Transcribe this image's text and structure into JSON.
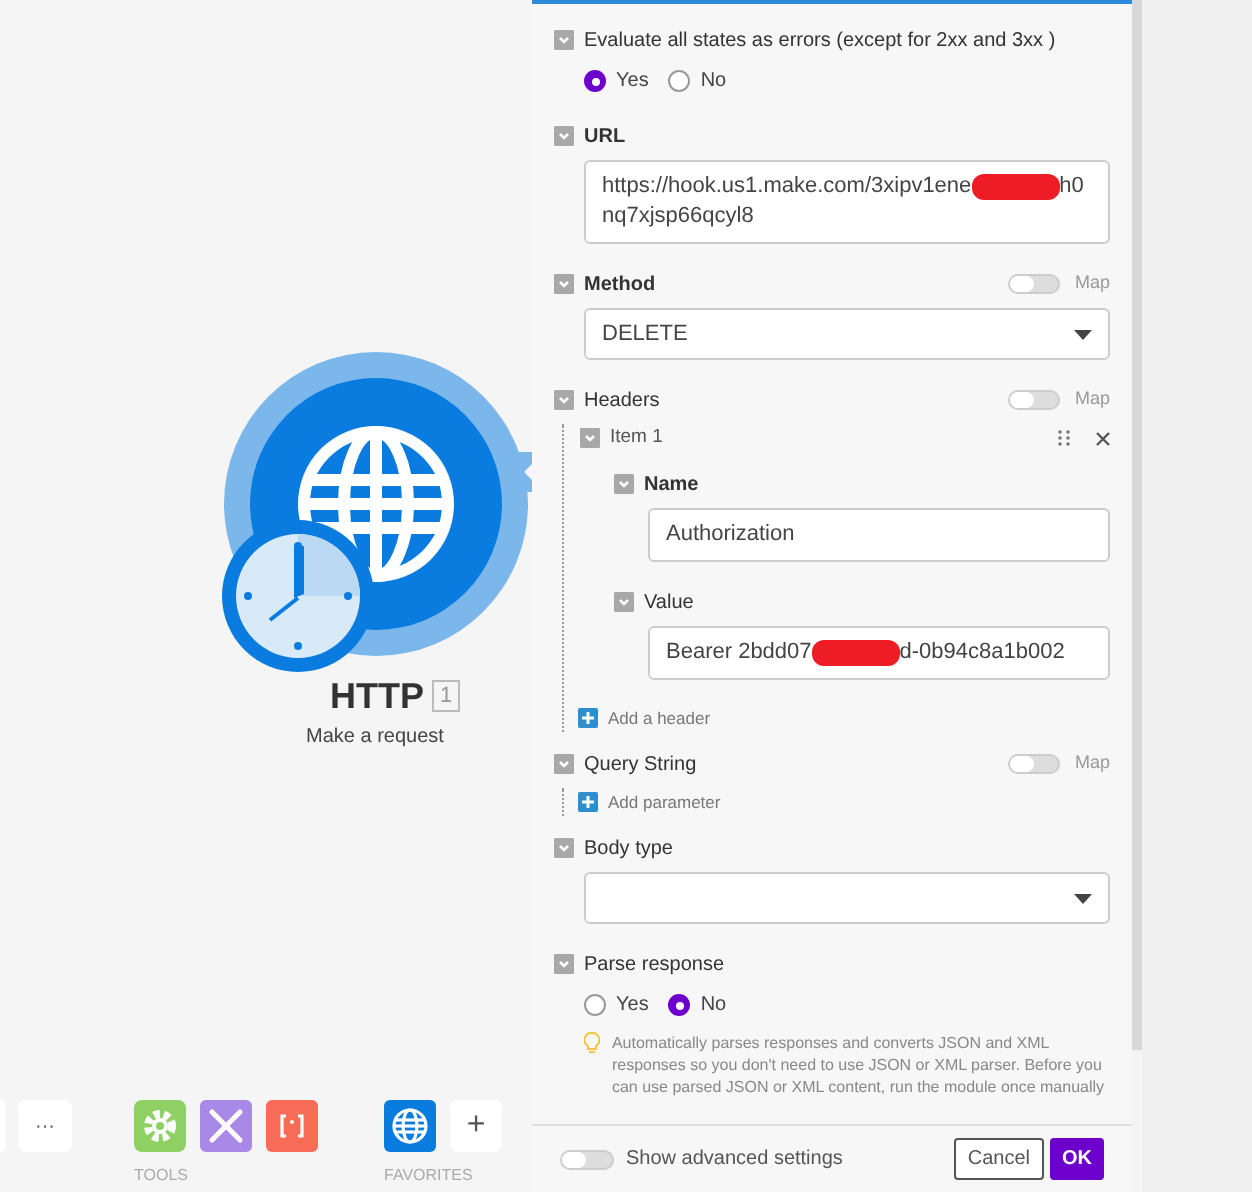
{
  "canvas": {
    "module": {
      "title": "HTTP",
      "badge": "1",
      "subtitle": "Make a request"
    },
    "toolbar": {
      "more_button": "···",
      "groups": [
        {
          "label": "TOOLS",
          "items": [
            {
              "kind": "gear"
            },
            {
              "kind": "tools"
            },
            {
              "kind": "brackets"
            }
          ]
        },
        {
          "label": "FAVORITES",
          "items": [
            {
              "kind": "globe"
            }
          ]
        }
      ],
      "add_button": "+"
    }
  },
  "panel": {
    "sections": [
      {
        "kind": "radio",
        "label": "Evaluate all states as errors (except for 2xx and 3xx )",
        "bold": false,
        "options": [
          {
            "label": "Yes",
            "selected": true
          },
          {
            "label": "No",
            "selected": false
          }
        ]
      },
      {
        "kind": "text",
        "label": "URL",
        "bold": true,
        "value": [
          {
            "kind": "text",
            "text": "https://hook.us1.make.com/3xipv1ene"
          },
          {
            "kind": "redacted"
          },
          {
            "kind": "text",
            "text": "h0nq7xjsp66qcyl8"
          }
        ]
      },
      {
        "kind": "select",
        "label": "Method",
        "bold": true,
        "map": {
          "label": "Map",
          "on": false
        },
        "value": "DELETE"
      },
      {
        "kind": "array",
        "label": "Headers",
        "bold": false,
        "map": {
          "label": "Map",
          "on": false
        },
        "items": [
          {
            "label": "Item 1",
            "fields": [
              {
                "label": "Name",
                "bold": true,
                "value": [
                  {
                    "kind": "text",
                    "text": "Authorization"
                  }
                ]
              },
              {
                "label": "Value",
                "bold": false,
                "value": [
                  {
                    "kind": "text",
                    "text": "Bearer 2bdd07"
                  },
                  {
                    "kind": "redacted"
                  },
                  {
                    "kind": "text",
                    "text": "d-0b94c8a1b002"
                  }
                ]
              }
            ]
          }
        ],
        "add_label": "Add a header"
      },
      {
        "kind": "array",
        "label": "Query String",
        "bold": false,
        "map": {
          "label": "Map",
          "on": false
        },
        "add_label": "Add parameter"
      },
      {
        "kind": "select",
        "label": "Body type",
        "bold": false
      },
      {
        "kind": "radio",
        "label": "Parse response",
        "bold": false,
        "options": [
          {
            "label": "Yes",
            "selected": false
          },
          {
            "label": "No",
            "selected": true
          }
        ],
        "hint": "Automatically parses responses and converts JSON and XML responses so you don't need to use JSON or XML parser. Before you can use parsed JSON or XML content, run the module once manually"
      }
    ],
    "footer": {
      "advanced": {
        "label": "Show advanced settings",
        "on": false
      },
      "buttons": [
        {
          "label": "Cancel",
          "kind": "secondary"
        },
        {
          "label": "OK",
          "kind": "primary"
        }
      ]
    }
  }
}
